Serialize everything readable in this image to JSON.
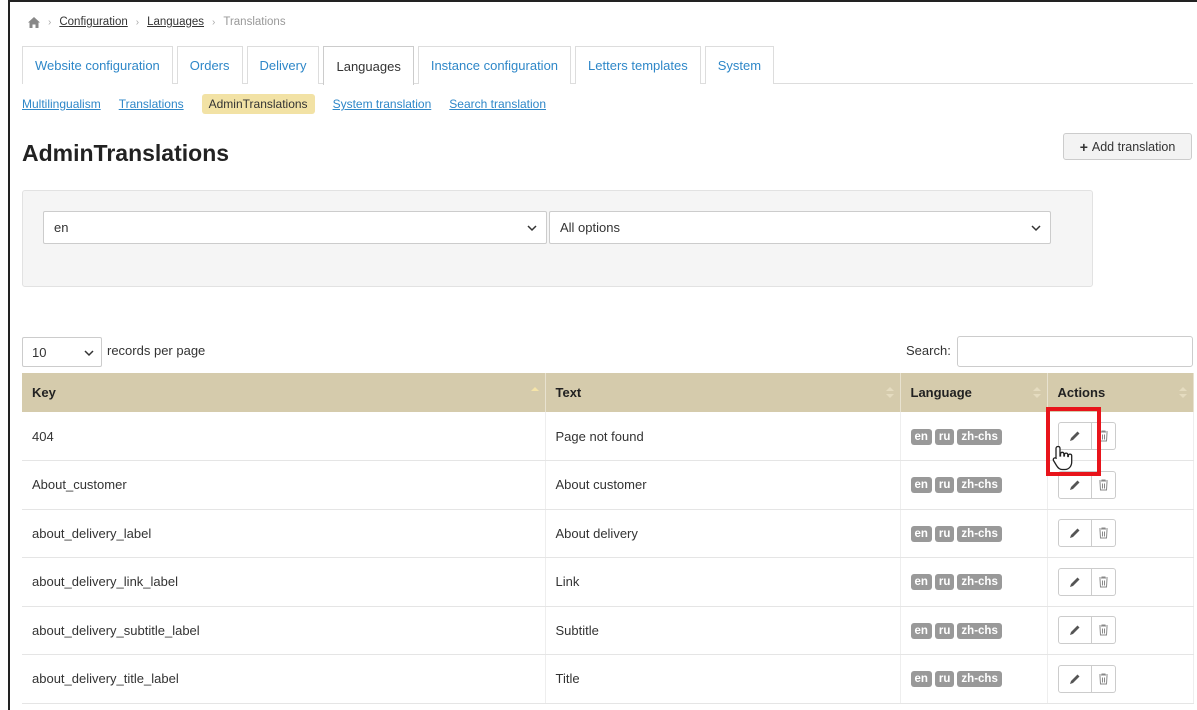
{
  "breadcrumb": {
    "items": [
      "Configuration",
      "Languages"
    ],
    "current": "Translations"
  },
  "tabs": [
    {
      "label": "Website configuration",
      "active": false
    },
    {
      "label": "Orders",
      "active": false
    },
    {
      "label": "Delivery",
      "active": false
    },
    {
      "label": "Languages",
      "active": true
    },
    {
      "label": "Instance configuration",
      "active": false
    },
    {
      "label": "Letters templates",
      "active": false
    },
    {
      "label": "System",
      "active": false
    }
  ],
  "subtabs": [
    {
      "label": "Multilingualism",
      "active": false
    },
    {
      "label": "Translations",
      "active": false
    },
    {
      "label": "AdminTranslations",
      "active": true
    },
    {
      "label": "System translation",
      "active": false
    },
    {
      "label": "Search translation",
      "active": false
    }
  ],
  "page": {
    "title": "AdminTranslations",
    "add_button": "Add translation"
  },
  "filters": {
    "language_value": "en",
    "options_value": "All options"
  },
  "table_controls": {
    "records_value": "10",
    "records_label": "records per page",
    "search_label": "Search:",
    "search_value": ""
  },
  "table": {
    "columns": [
      "Key",
      "Text",
      "Language",
      "Actions"
    ],
    "rows": [
      {
        "key": "404",
        "text": "Page not found",
        "languages": [
          "en",
          "ru",
          "zh-chs"
        ]
      },
      {
        "key": "About_customer",
        "text": "About customer",
        "languages": [
          "en",
          "ru",
          "zh-chs"
        ]
      },
      {
        "key": "about_delivery_label",
        "text": "About delivery",
        "languages": [
          "en",
          "ru",
          "zh-chs"
        ]
      },
      {
        "key": "about_delivery_link_label",
        "text": "Link",
        "languages": [
          "en",
          "ru",
          "zh-chs"
        ]
      },
      {
        "key": "about_delivery_subtitle_label",
        "text": "Subtitle",
        "languages": [
          "en",
          "ru",
          "zh-chs"
        ]
      },
      {
        "key": "about_delivery_title_label",
        "text": "Title",
        "languages": [
          "en",
          "ru",
          "zh-chs"
        ]
      }
    ]
  },
  "colors": {
    "link": "#2e87c8",
    "header_bg": "#d5cbac",
    "active_subtab_bg": "#f2e2a5",
    "badge_bg": "#999999",
    "highlight": "#e8141b"
  },
  "icons": {
    "home": "home-icon",
    "edit": "pencil-icon",
    "delete": "trash-icon",
    "cursor": "hand-pointer-icon"
  }
}
